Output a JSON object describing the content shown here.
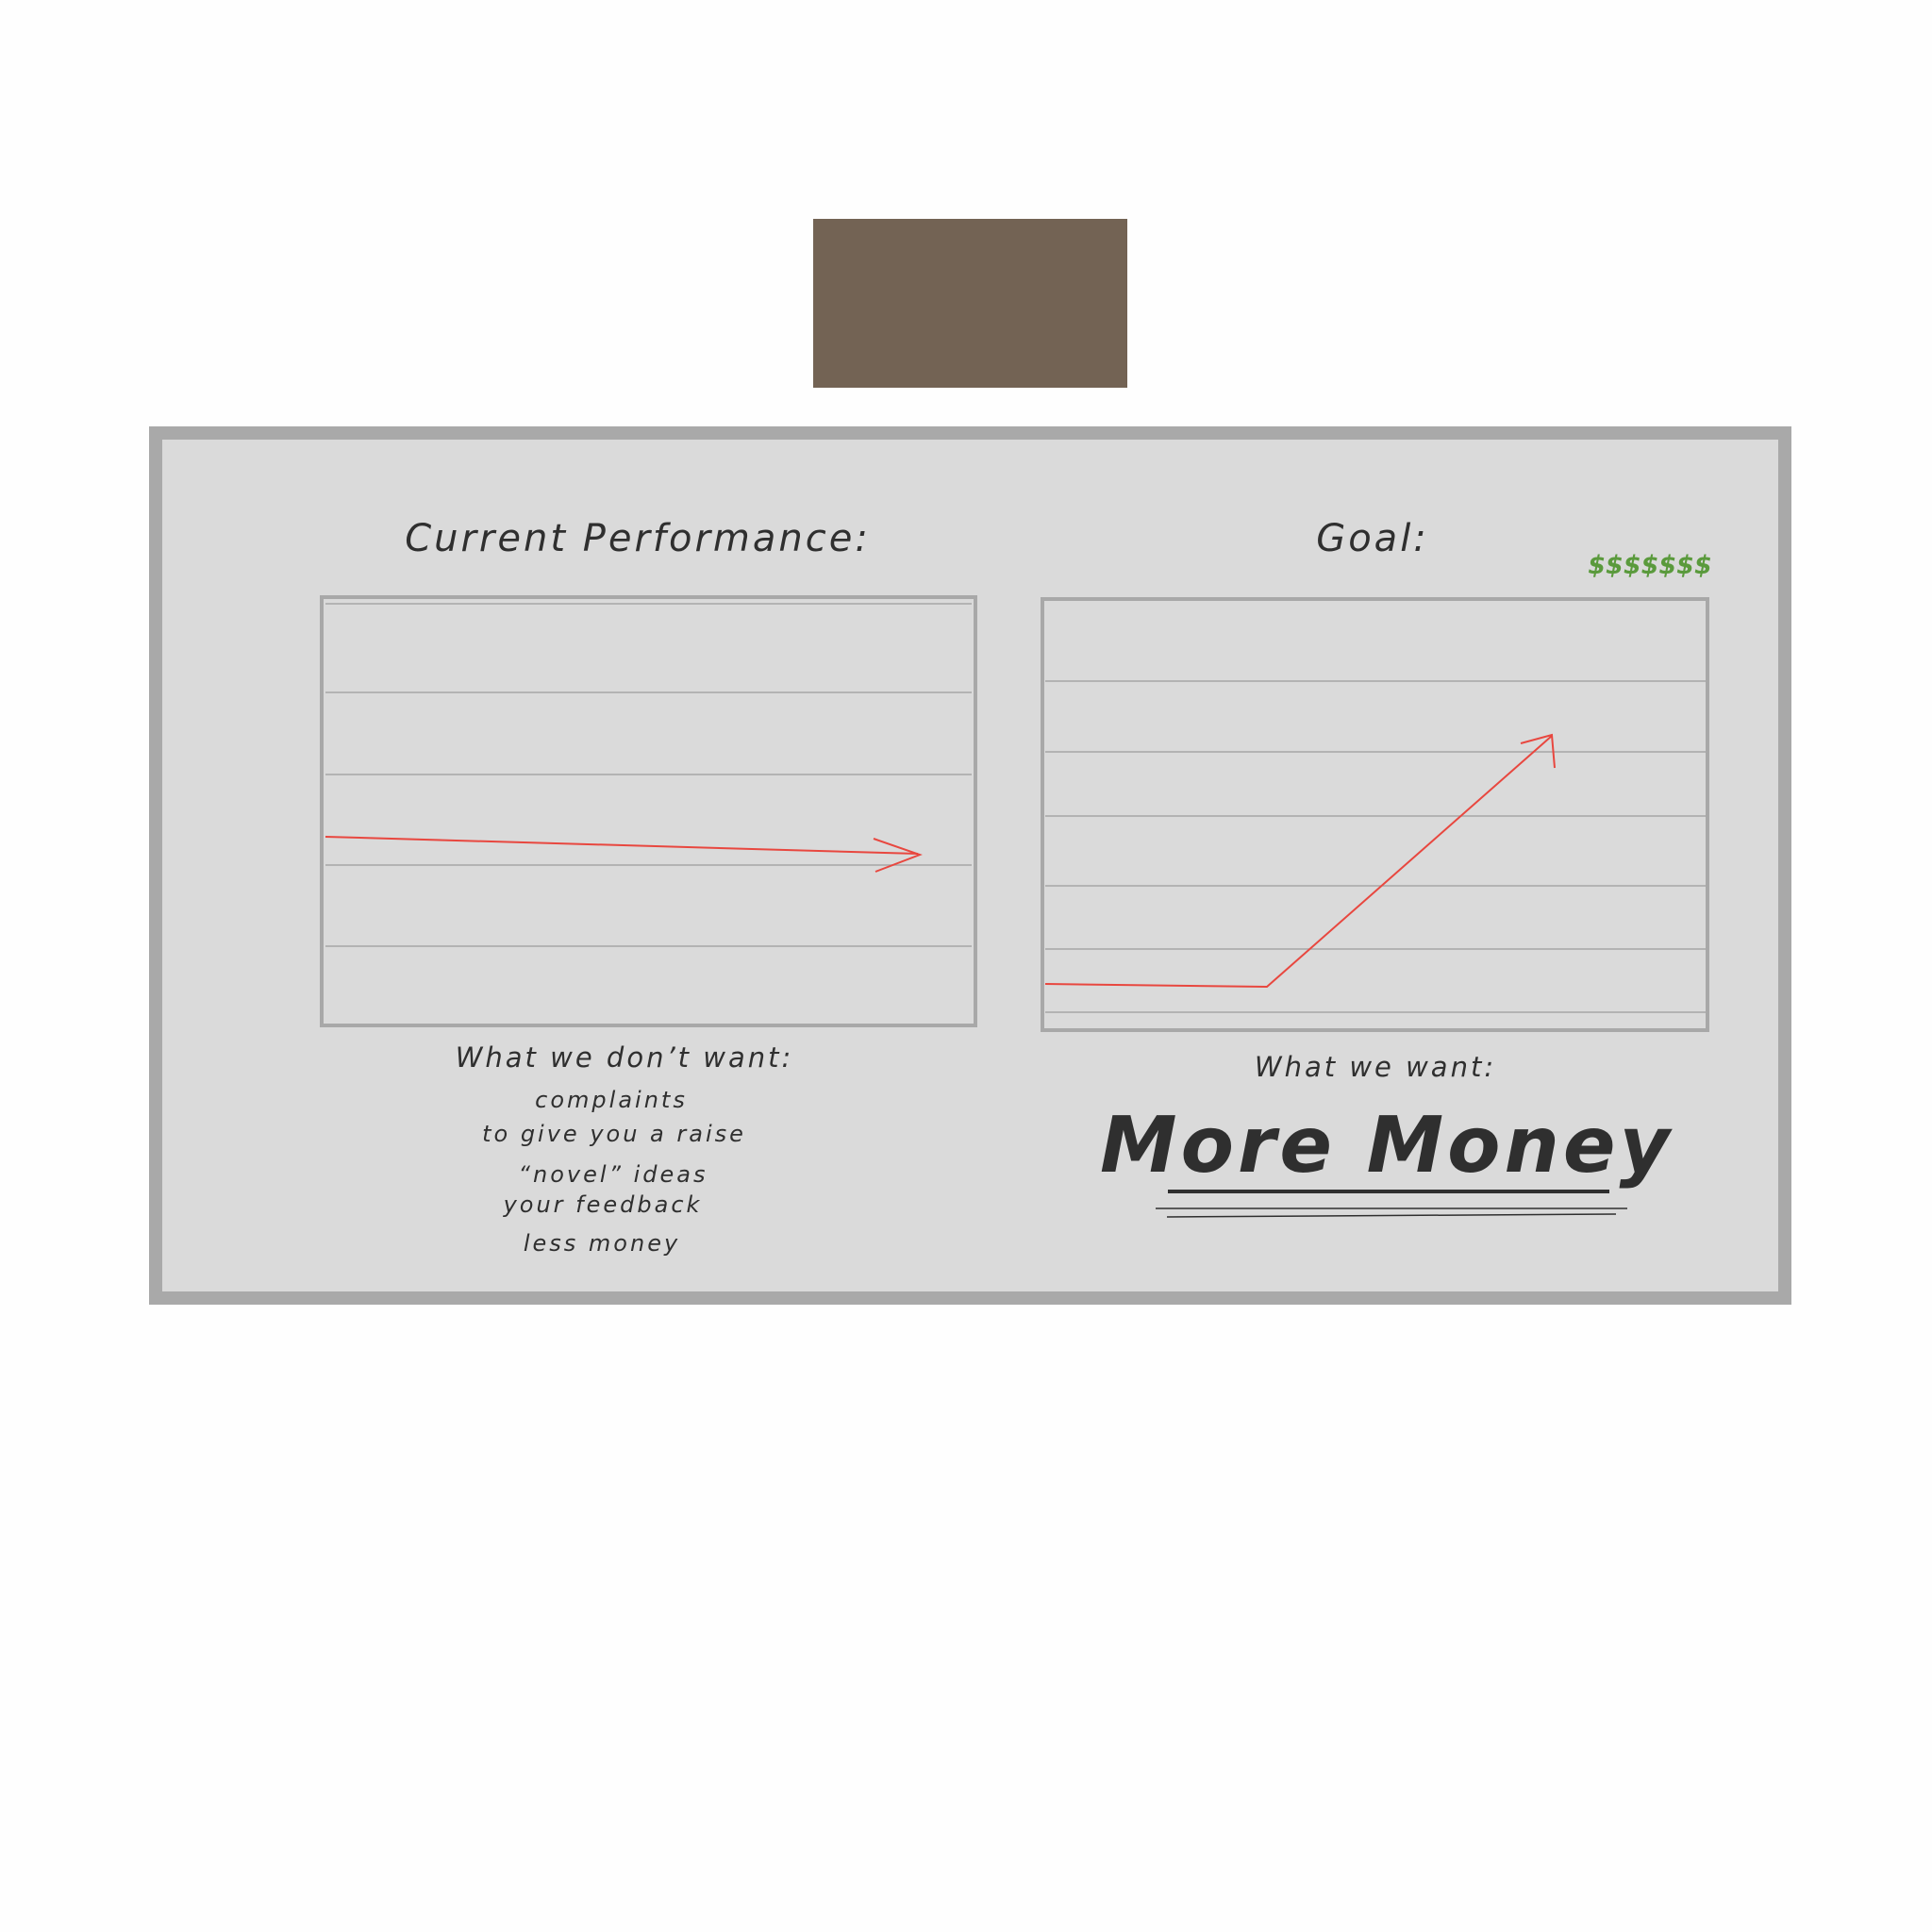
{
  "board": {
    "left_panel": {
      "title": "Current Performance:",
      "caption": "What we don’t want:",
      "items": [
        "complaints",
        "to give you a raise",
        "“novel” ideas",
        "your feedback",
        "less money"
      ]
    },
    "right_panel": {
      "title": "Goal:",
      "annotation": "$$$$$$$",
      "caption": "What we want:",
      "headline": "More Money"
    }
  },
  "colors": {
    "board_bg": "#dadada",
    "frame": "#a9a9a9",
    "ink": "#2f2f2f",
    "arrow": "#e8473f",
    "money_green": "#5a9a3c",
    "top_block": "#736354"
  }
}
